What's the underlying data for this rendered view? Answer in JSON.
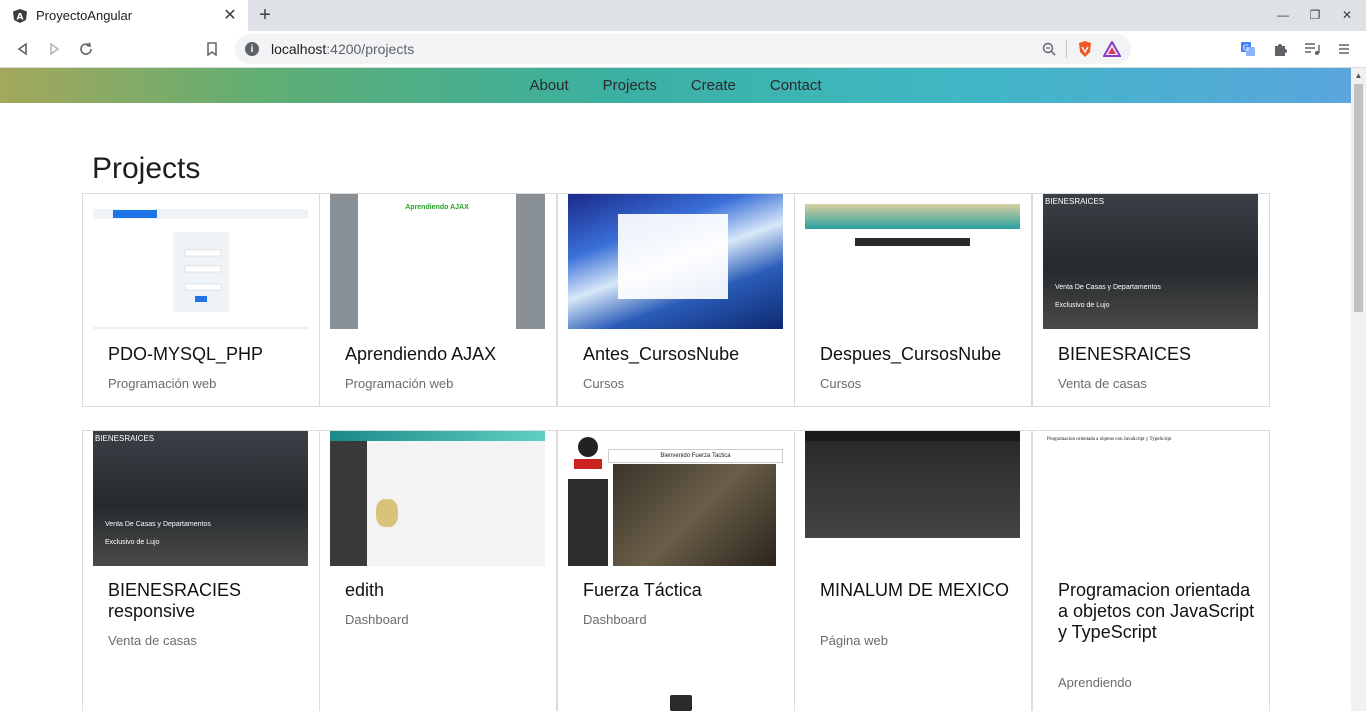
{
  "browser": {
    "tab_title": "ProyectoAngular",
    "url_host": "localhost",
    "url_path": ":4200/projects"
  },
  "site": {
    "nav": [
      "About",
      "Projects",
      "Create",
      "Contact"
    ],
    "page_title": "Projects"
  },
  "projects": [
    {
      "name": "PDO-MYSQL_PHP",
      "category": "Programación web",
      "thumb": "t-pdo"
    },
    {
      "name": "Aprendiendo AJAX",
      "category": "Programación web",
      "thumb": "t-ajax"
    },
    {
      "name": "Antes_CursosNube",
      "category": "Cursos",
      "thumb": "t-wave"
    },
    {
      "name": "Despues_CursosNube",
      "category": "Cursos",
      "thumb": "t-cn"
    },
    {
      "name": "BIENESRAICES",
      "category": "Venta de casas",
      "thumb": "t-house"
    },
    {
      "name": "BIENESRACIES responsive",
      "category": "Venta de casas",
      "thumb": "t-house"
    },
    {
      "name": "edith",
      "category": "Dashboard",
      "thumb": "t-edith"
    },
    {
      "name": "Fuerza Táctica",
      "category": "Dashboard",
      "thumb": "t-ft"
    },
    {
      "name": "MINALUM DE MEXICO",
      "category": "Página web",
      "thumb": "t-min"
    },
    {
      "name": "Programacion orientada a objetos con JavaScript y TypeScript",
      "category": "Aprendiendo",
      "thumb": "t-poo"
    }
  ],
  "thumb_text": {
    "ajax_heading": "Aprendiendo AJAX",
    "house_logo": "BIENESRAICES",
    "house_line1": "Venta De Casas y Departamentos",
    "house_line2": "Exclusivo de Lujo",
    "ft_heading": "Bienvenido Fuerza Tactica",
    "poo_heading": "Programacion orientada a objetos con JavaScript y TypeScript"
  }
}
